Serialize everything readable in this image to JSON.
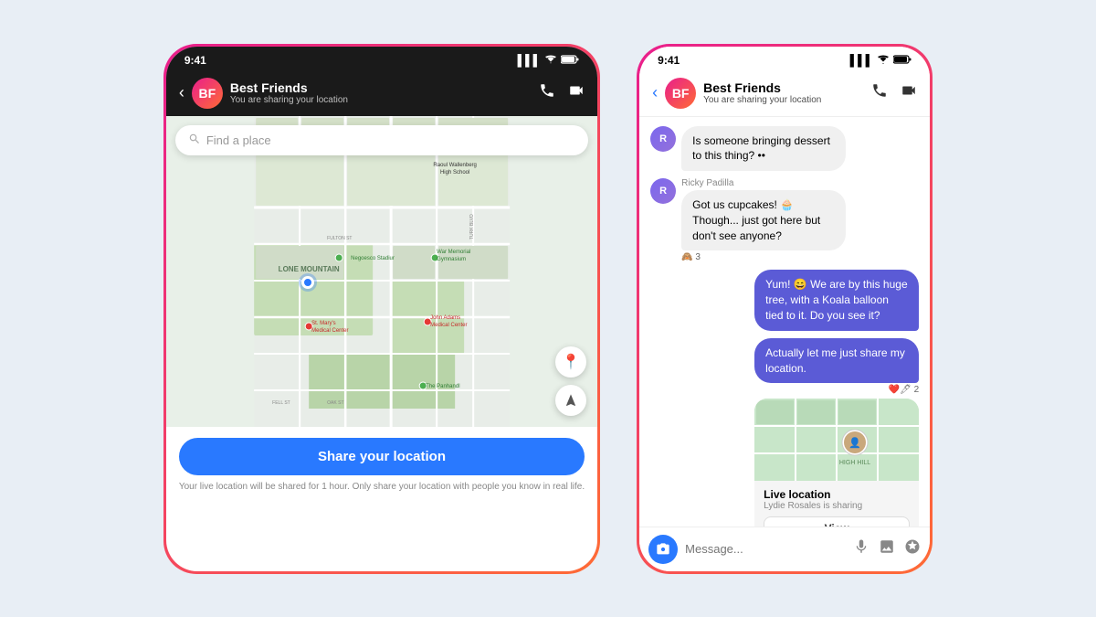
{
  "app": {
    "background": "#e8eef5"
  },
  "phone_left": {
    "status_bar": {
      "time": "9:41",
      "signal": "▌▌▌",
      "wifi": "WiFi",
      "battery": "🔋"
    },
    "header": {
      "back": "‹",
      "group_name": "Best Friends",
      "subtitle": "You are sharing your location",
      "call_icon": "📞",
      "video_icon": "⬜"
    },
    "search_placeholder": "Find a place",
    "map_labels": {
      "lone_mountain": "LONE MOUNTAIN",
      "raoul_high": "Raoul Wallenberg High School",
      "negoesco": "Negoesco Stadiur",
      "war_memorial": "War Memorial Gymnasium",
      "st_marys": "St. Mary's Medical Center",
      "john_adams": "John Adams\nMedical Center",
      "panhandle": "The Panhandl"
    },
    "share_button_label": "Share your location",
    "share_note": "Your live location will be shared for 1 hour. Only share your location with people you know in real life."
  },
  "phone_right": {
    "status_bar": {
      "time": "9:41",
      "signal": "▌▌▌",
      "wifi": "WiFi",
      "battery": "🔋"
    },
    "header": {
      "back": "‹",
      "group_name": "Best Friends",
      "subtitle": "You are sharing your location",
      "call_icon": "📞",
      "video_icon": "⬜"
    },
    "messages": [
      {
        "type": "received",
        "text": "Is someone bringing dessert to this thing? ••",
        "sender": ""
      },
      {
        "type": "received",
        "sender": "Ricky Padilla",
        "text": "Got us cupcakes! 🧁 Though... just got here but don't see anyone?",
        "reactions": "🙈 3"
      },
      {
        "type": "sent",
        "text": "Yum! 😄 We are by this huge tree, with a Koala balloon tied to it. Do you see it?"
      },
      {
        "type": "sent",
        "text": "Actually let me just share my location.",
        "reactions": "❤️🖊 2"
      }
    ],
    "location_card": {
      "title": "Live location",
      "subtitle": "Lydie Rosales is sharing",
      "view_label": "View"
    },
    "message_placeholder": "Message...",
    "input_icons": [
      "🎤",
      "🖼",
      "🎭"
    ]
  }
}
